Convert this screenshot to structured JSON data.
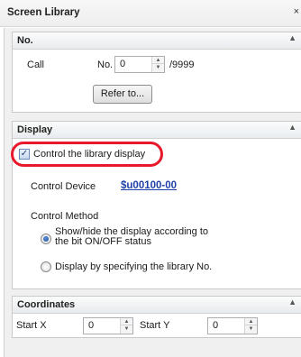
{
  "window": {
    "title": "Screen Library",
    "close_glyph": "×"
  },
  "no_section": {
    "title": "No.",
    "call_label": "Call",
    "no_label": "No.",
    "no_value": "0",
    "max_label": "/9999",
    "refer_button": "Refer to..."
  },
  "display_section": {
    "title": "Display",
    "control_checkbox_label": "Control the library display",
    "control_checkbox_checked": true,
    "control_device_label": "Control Device",
    "control_device_value": "$u00100-00",
    "control_method_label": "Control Method",
    "radio_bit_label_line1": "Show/hide the display according to",
    "radio_bit_label_line2": "the bit ON/OFF status",
    "radio_bit_selected": true,
    "radio_libno_label": "Display by specifying the library No.",
    "radio_libno_selected": false
  },
  "coordinates_section": {
    "title": "Coordinates",
    "start_x_label": "Start X",
    "start_x_value": "0",
    "start_y_label": "Start Y",
    "start_y_value": "0"
  },
  "colors": {
    "highlight": "#e8192c",
    "link": "#1f3fa8",
    "section_header": "#e9ecef"
  }
}
